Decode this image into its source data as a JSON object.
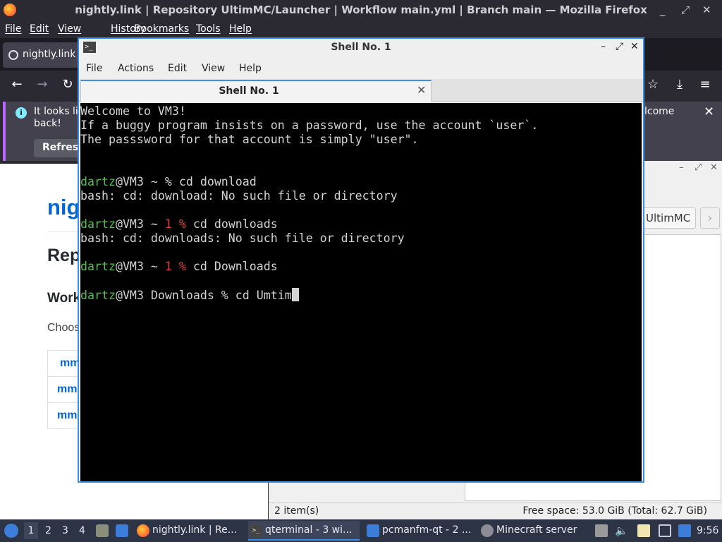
{
  "firefox": {
    "window_title": "nightly.link | Repository UltimMC/Launcher | Workflow main.yml | Branch main — Mozilla Firefox",
    "menu": [
      "File",
      "Edit",
      "View",
      "History",
      "Bookmarks",
      "Tools",
      "Help"
    ],
    "tab_title": "nightly.link |",
    "notice": {
      "line1": "It looks lik",
      "line2": "back!",
      "refresh_label": "Refresh",
      "right_text": "lcome"
    },
    "page": {
      "h1": "nig",
      "h2": "Rep",
      "h3": "Work",
      "choose": "Choos",
      "rows": [
        "mm",
        "mm",
        "mm"
      ]
    }
  },
  "file_manager": {
    "crumb": "UltimMC",
    "crumb_next": "›",
    "status_items": "2 item(s)",
    "status_free": "Free space: 53.0 GiB (Total: 62.7 GiB)"
  },
  "terminal": {
    "title": "Shell No. 1",
    "menu": [
      "File",
      "Actions",
      "Edit",
      "View",
      "Help"
    ],
    "tab_label": "Shell No. 1",
    "tab_close": "✕",
    "lines": {
      "l1": "Welcome to VM3!",
      "l2": "If a buggy program insists on a password, use the account `user`.",
      "l3": "The passsword for that account is simply \"user\".",
      "p1_user": "dartz",
      "p1_host": "@VM3 ~ % cd download",
      "e1": "bash: cd: download: No such file or directory",
      "p2_user": "dartz",
      "p2_host": "@VM3 ~ ",
      "p2_err": "1 %",
      "p2_cmd": " cd downloads",
      "e2": "bash: cd: downloads: No such file or directory",
      "p3_user": "dartz",
      "p3_host": "@VM3 ~ ",
      "p3_err": "1 %",
      "p3_cmd": " cd Downloads",
      "p4_user": "dartz",
      "p4_host": "@VM3 Downloads % cd Umtim"
    }
  },
  "taskbar": {
    "desktops": [
      "1",
      "2",
      "3",
      "4"
    ],
    "tasks": {
      "firefox": "nightly.link | Re...",
      "terminal": "qterminal - 3 wi...",
      "filemanager": "pcmanfm-qt - 2 ...",
      "minecraft": "Minecraft server"
    },
    "clock": "9:56"
  },
  "colors": {
    "terminal_user": "#4ec24e",
    "terminal_error": "#e04040",
    "accent": "#3d8ee8"
  }
}
